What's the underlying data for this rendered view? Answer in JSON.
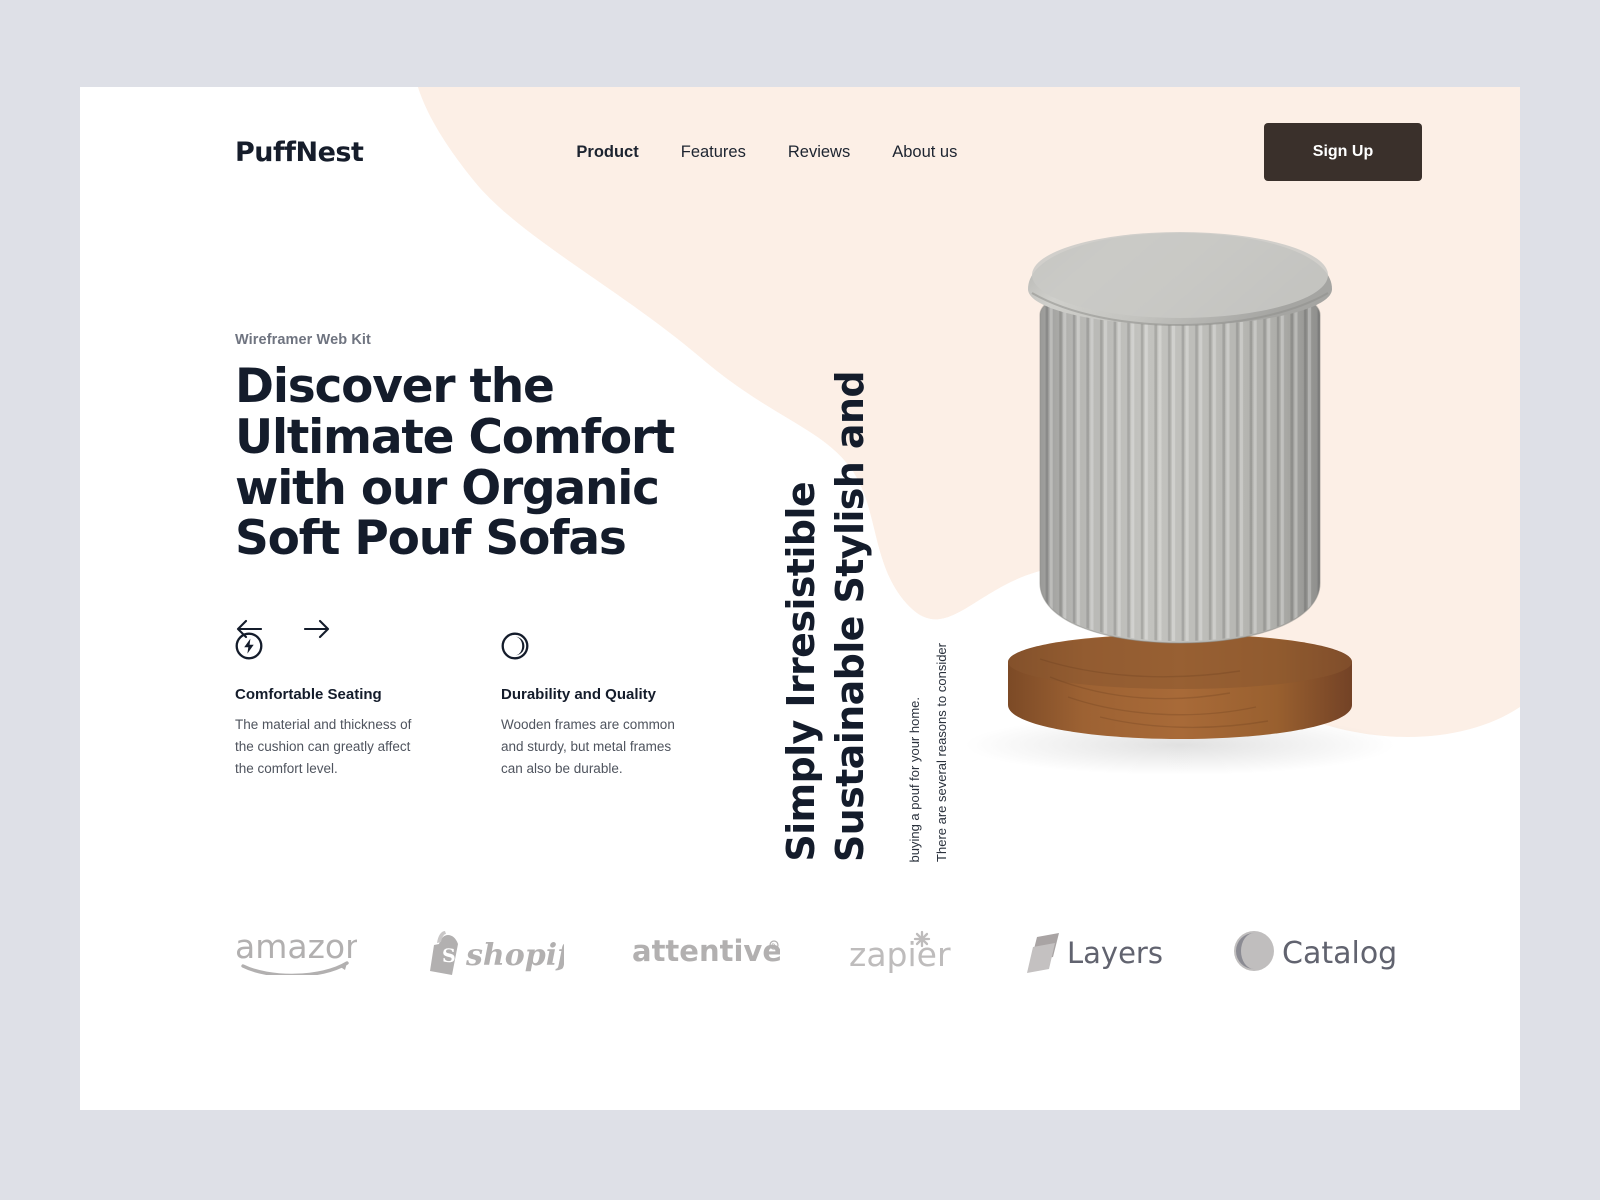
{
  "theme": {
    "page_bg": "#dee0e7",
    "card_bg": "#ffffff",
    "accent_peach": "#fcefe6",
    "dark": "#141c2b",
    "button_bg": "#3a302b",
    "muted": "#4f545e",
    "logo_gray": "#b0aeae"
  },
  "header": {
    "logo": "PuffNest",
    "nav": [
      {
        "label": "Product",
        "active": true
      },
      {
        "label": "Features",
        "active": false
      },
      {
        "label": "Reviews",
        "active": false
      },
      {
        "label": "About us",
        "active": false
      }
    ],
    "signup_label": "Sign Up"
  },
  "hero": {
    "eyebrow": "Wireframer Web Kit",
    "headline": "Discover the Ultimate Comfort with our Organic Soft Pouf Sofas",
    "prev_label": "Previous",
    "next_label": "Next"
  },
  "features": [
    {
      "icon": "lightning-bolt-circle-icon",
      "title": "Comfortable Seating",
      "desc": "The material and thickness of the cushion can greatly affect the comfort level."
    },
    {
      "icon": "half-filled-circle-icon",
      "title": "Durability and Quality",
      "desc": "Wooden frames are common and sturdy, but metal frames can also be durable."
    }
  ],
  "vertical": {
    "heading_line1": "Sustainable Stylish and",
    "heading_line2": "Simply Irresistible",
    "sub_line1": "There are several reasons to consider",
    "sub_line2": "buying a pouf for your home."
  },
  "product": {
    "alt": "Gray ribbed fabric pouf ottoman with wooden base"
  },
  "brands": [
    {
      "name": "amazon",
      "label": "amazon"
    },
    {
      "name": "shopify",
      "label": "shopify"
    },
    {
      "name": "attentive",
      "label": "attentive"
    },
    {
      "name": "zapier",
      "label": "zapier"
    },
    {
      "name": "layers",
      "label": "Layers"
    },
    {
      "name": "catalog",
      "label": "Catalog"
    }
  ]
}
